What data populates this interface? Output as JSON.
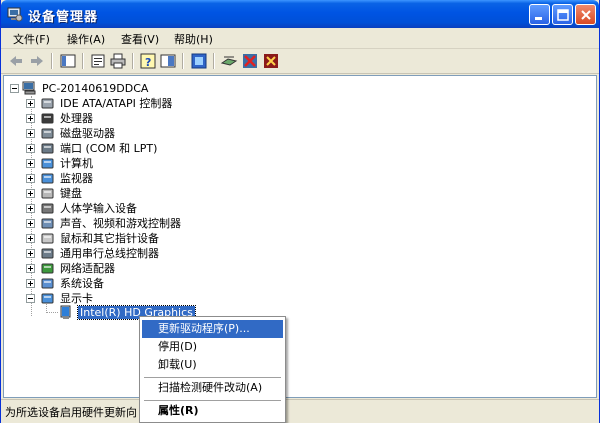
{
  "window": {
    "title": "设备管理器",
    "controls": {
      "minimize": "minimize-icon",
      "maximize": "maximize-icon",
      "close": "close-icon"
    }
  },
  "menubar": {
    "items": [
      {
        "label": "文件(F)"
      },
      {
        "label": "操作(A)"
      },
      {
        "label": "查看(V)"
      },
      {
        "label": "帮助(H)"
      }
    ]
  },
  "toolbar": {
    "icons": [
      "back-icon",
      "forward-icon",
      "show-hide-tree-icon",
      "properties-icon",
      "print-icon",
      "help-icon",
      "view-icon",
      "update-driver-icon",
      "scan-hardware-icon",
      "disable-icon",
      "uninstall-icon"
    ]
  },
  "tree": {
    "root": {
      "label": "PC-20140619DDCA"
    },
    "categories": [
      {
        "label": "IDE ATA/ATAPI 控制器",
        "expanded": false
      },
      {
        "label": "处理器",
        "expanded": false
      },
      {
        "label": "磁盘驱动器",
        "expanded": false
      },
      {
        "label": "端口 (COM 和 LPT)",
        "expanded": false
      },
      {
        "label": "计算机",
        "expanded": false
      },
      {
        "label": "监视器",
        "expanded": false
      },
      {
        "label": "键盘",
        "expanded": false
      },
      {
        "label": "人体学输入设备",
        "expanded": false
      },
      {
        "label": "声音、视频和游戏控制器",
        "expanded": false
      },
      {
        "label": "鼠标和其它指针设备",
        "expanded": false
      },
      {
        "label": "通用串行总线控制器",
        "expanded": false
      },
      {
        "label": "网络适配器",
        "expanded": false
      },
      {
        "label": "系统设备",
        "expanded": false
      },
      {
        "label": "显示卡",
        "expanded": true
      }
    ],
    "selected_device": {
      "label": "Intel(R) HD Graphics"
    }
  },
  "context_menu": {
    "items": [
      {
        "label": "更新驱动程序(P)...",
        "highlighted": true
      },
      {
        "label": "停用(D)"
      },
      {
        "label": "卸载(U)"
      },
      {
        "label": "扫描检测硬件改动(A)"
      },
      {
        "label": "属性(R)",
        "bold": true
      }
    ]
  },
  "statusbar": {
    "text": "为所选设备启用硬件更新向"
  },
  "colors": {
    "titlebar": "#0054e3",
    "selection": "#316ac5",
    "window_bg": "#ece9d8"
  }
}
